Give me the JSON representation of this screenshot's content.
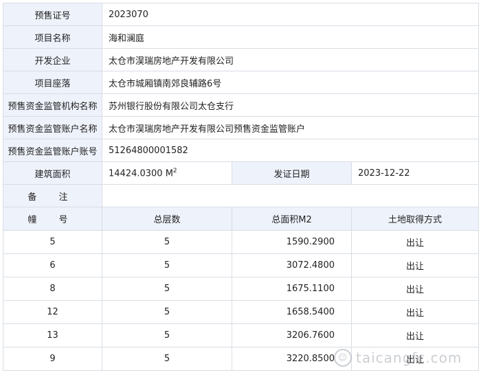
{
  "info_rows": [
    {
      "label": "预售证号",
      "value": "2023070"
    },
    {
      "label": "项目名称",
      "value": "海和澜庭"
    },
    {
      "label": "开发企业",
      "value": "太仓市淏瑞房地产开发有限公司"
    },
    {
      "label": "项目座落",
      "value": "太仓市城厢镇南郊良辅路6号"
    },
    {
      "label": "预售资金监管机构名称",
      "value": "苏州银行股份有限公司太仓支行"
    },
    {
      "label": "预售资金监管账户名称",
      "value": "太仓市淏瑞房地产开发有限公司预售资金监管账户"
    },
    {
      "label": "预售资金监管账户账号",
      "value": "51264800001582"
    }
  ],
  "area_row": {
    "area_label": "建筑面积",
    "area_value": "14424.0300 M",
    "area_sup": "2",
    "date_label": "发证日期",
    "date_value": "2023-12-22"
  },
  "remark": {
    "label": "备 注",
    "value": ""
  },
  "building_table": {
    "headers": [
      "幢 号",
      "总层数",
      "总面积M2",
      "土地取得方式"
    ],
    "rows": [
      [
        "5",
        "5",
        "1590.2900",
        "出让"
      ],
      [
        "6",
        "5",
        "3072.4800",
        "出让"
      ],
      [
        "8",
        "5",
        "1675.1100",
        "出让"
      ],
      [
        "12",
        "5",
        "1658.5400",
        "出让"
      ],
      [
        "13",
        "5",
        "3206.7600",
        "出让"
      ],
      [
        "9",
        "5",
        "3220.8500",
        "出让"
      ]
    ]
  },
  "watermark": {
    "text": "taicangfc.com",
    "icon": "smiley-circle-icon"
  }
}
